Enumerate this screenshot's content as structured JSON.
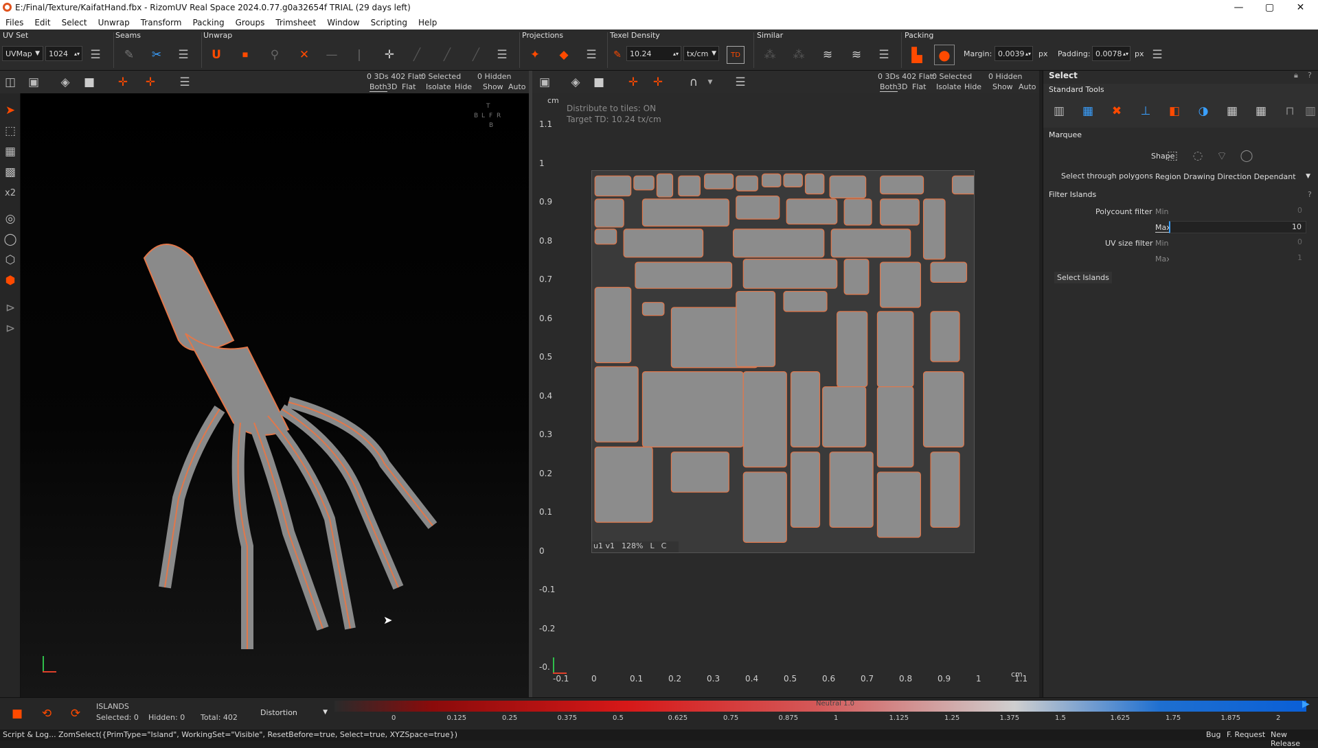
{
  "window": {
    "title": "E:/Final/Texture/KaifatHand.fbx - RizomUV  Real Space 2024.0.77.g0a32654f TRIAL (29 days left)",
    "minimize": "—",
    "maximize": "▢",
    "close": "✕"
  },
  "menu": [
    "Files",
    "Edit",
    "Select",
    "Unwrap",
    "Transform",
    "Packing",
    "Groups",
    "Trimsheet",
    "Window",
    "Scripting",
    "Help"
  ],
  "toolbar": {
    "uvset_label": "UV Set",
    "uvset_value": "UVMap",
    "uvset_res": "1024",
    "seams_label": "Seams",
    "unwrap_label": "Unwrap",
    "projections_label": "Projections",
    "texel_label": "Texel Density",
    "texel_value": "10.24",
    "texel_unit": "tx/cm",
    "similar_label": "Similar",
    "packing_label": "Packing",
    "margin_label": "Margin:",
    "margin_value": "0.0039",
    "margin_unit": "px",
    "padding_label": "Padding:",
    "padding_value": "0.0078",
    "padding_unit": "px"
  },
  "view3d_bar": {
    "counts": "0 3Ds 402 Flat:",
    "selected": "0 Selected",
    "hidden": "0 Hidden",
    "both": "Both",
    "three_d": "3D",
    "flat": "Flat",
    "isolate": "Isolate",
    "hide": "Hide",
    "show": "Show",
    "auto": "Auto"
  },
  "uv_bar": {
    "counts": "0 3Ds 402 Flat:",
    "selected": "0 Selected",
    "hidden": "0 Hidden",
    "both": "Both",
    "three_d": "3D",
    "flat": "Flat",
    "isolate": "Isolate",
    "hide": "Hide",
    "show": "Show",
    "auto": "Auto"
  },
  "view3d": {
    "cube_t": "T",
    "cube_b1": "B",
    "cube_l": "L",
    "cube_f": "F",
    "cube_r": "R",
    "cube_b2": "B"
  },
  "uv": {
    "unit": "cm",
    "distribute": "Distribute to tiles: ON",
    "target": "Target TD: 10.24 tx/cm",
    "tile_info_u": "u1 v1",
    "tile_info_zoom": "128%",
    "tile_info_l": "L",
    "tile_info_c": "C",
    "y_ticks": [
      "1.1",
      "1",
      "0.9",
      "0.8",
      "0.7",
      "0.6",
      "0.5",
      "0.4",
      "0.3",
      "0.2",
      "0.1",
      "0",
      "-0.1",
      "-0.2",
      "-0."
    ],
    "x_ticks": [
      "-0.1",
      "0",
      "0.1",
      "0.2",
      "0.3",
      "0.4",
      "0.5",
      "0.6",
      "0.7",
      "0.8",
      "0.9",
      "1",
      "1.1"
    ],
    "x_unit": "cm"
  },
  "rpanel": {
    "select_title": "Select",
    "standard_tools": "Standard Tools",
    "marquee": "Marquee",
    "shape_label": "Shape",
    "select_through_label": "Select through polygons",
    "select_through_value": "Region Drawing Direction Dependant",
    "filter_islands": "Filter Islands",
    "polycount_label": "Polycount filter",
    "min": "Min",
    "max": "Max",
    "poly_min": "0",
    "poly_max": "10",
    "uvsize_label": "UV size filter",
    "uv_min": "0",
    "uv_max": "1",
    "select_islands": "Select Islands",
    "help": "?"
  },
  "bottom": {
    "islands": "ISLANDS",
    "selected": "Selected: 0",
    "hidden": "Hidden: 0",
    "total": "Total: 402",
    "mode": "Distortion",
    "neutral": "Neutral 1.0",
    "scale": [
      "0",
      "0.125",
      "0.25",
      "0.375",
      "0.5",
      "0.625",
      "0.75",
      "0.875",
      "1",
      "1.125",
      "1.25",
      "1.375",
      "1.5",
      "1.625",
      "1.75",
      "1.875",
      "2"
    ]
  },
  "status": {
    "script": "Script & Log...",
    "command": "ZomSelect({PrimType=\"Island\", WorkingSet=\"Visible\", ResetBefore=true, Select=true, XYZSpace=true})",
    "bug": "Bug",
    "feature": "F. Request",
    "release": "New Release"
  },
  "colors": {
    "accent": "#ff4a00",
    "island_fill": "#8c8c8c",
    "island_edge": "#e2774a"
  }
}
